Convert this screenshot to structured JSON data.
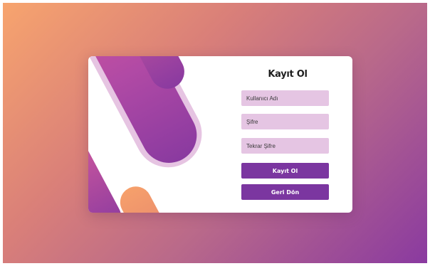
{
  "register_form": {
    "title": "Kayıt Ol",
    "username_placeholder": "Kullanıcı Adı",
    "password_placeholder": "Şifre",
    "repeat_password_placeholder": "Tekrar Şifre",
    "register_button": "Kayıt Ol",
    "back_button": "Geri Dön"
  },
  "colors": {
    "background_gradient": [
      "#f7a46e",
      "#d97f79",
      "#b9698a",
      "#8a3aa0"
    ],
    "field_background": "#e5c5e3",
    "button_background": "#7b36a0",
    "art_pink": "#e15a98",
    "art_purple": "#8a3aa0",
    "art_orange": "#f6a06b",
    "art_outline": "#e6c4e2"
  }
}
